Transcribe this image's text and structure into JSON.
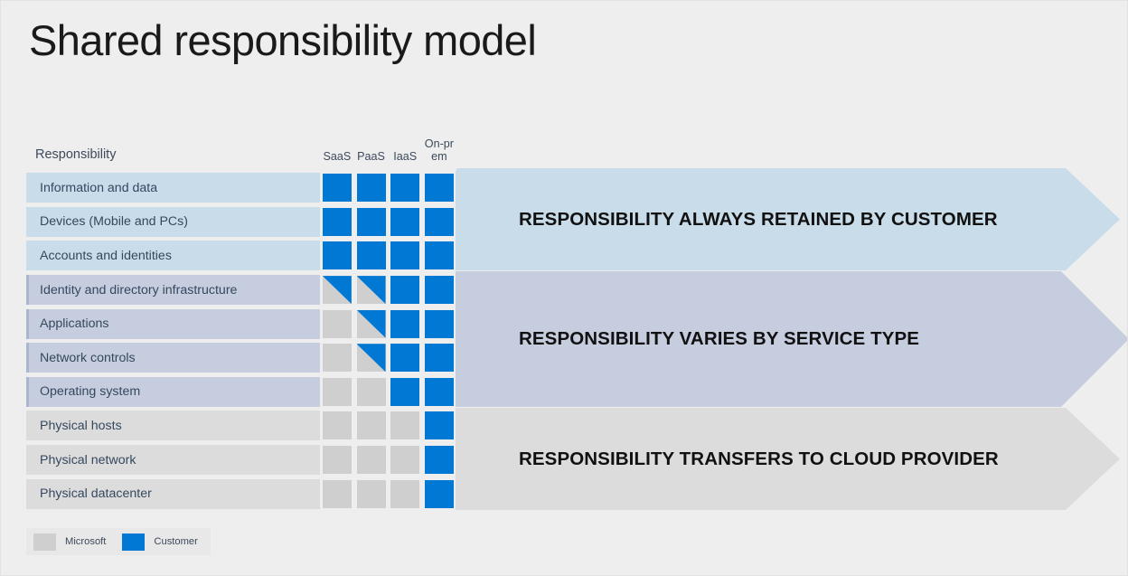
{
  "slide": {
    "title": "Shared responsibility model",
    "background_color": "#eeeeee"
  },
  "colors": {
    "customer_blue": "#0078d4",
    "microsoft_gray": "#cfcfcf",
    "band_customer": "#c9dcea",
    "band_varies": "#c5cddf",
    "band_provider": "#dcdcdc"
  },
  "table": {
    "headers": {
      "responsibility": "Responsibility",
      "columns": [
        "SaaS",
        "PaaS",
        "IaaS",
        "On-prem"
      ]
    },
    "rows": [
      {
        "label": "Information and data",
        "group": 1,
        "cells": [
          "cu",
          "cu",
          "cu",
          "cu"
        ]
      },
      {
        "label": "Devices (Mobile and PCs)",
        "group": 1,
        "cells": [
          "cu",
          "cu",
          "cu",
          "cu"
        ]
      },
      {
        "label": "Accounts and identities",
        "group": 1,
        "cells": [
          "cu",
          "cu",
          "cu",
          "cu"
        ]
      },
      {
        "label": "Identity and directory infrastructure",
        "group": 2,
        "cells": [
          "split",
          "split",
          "cu",
          "cu"
        ]
      },
      {
        "label": "Applications",
        "group": 2,
        "cells": [
          "ms",
          "split",
          "cu",
          "cu"
        ]
      },
      {
        "label": "Network controls",
        "group": 2,
        "cells": [
          "ms",
          "split",
          "cu",
          "cu"
        ]
      },
      {
        "label": "Operating system",
        "group": 2,
        "cells": [
          "ms",
          "ms",
          "cu",
          "cu"
        ]
      },
      {
        "label": "Physical hosts",
        "group": 3,
        "cells": [
          "ms",
          "ms",
          "ms",
          "cu"
        ]
      },
      {
        "label": "Physical network",
        "group": 3,
        "cells": [
          "ms",
          "ms",
          "ms",
          "cu"
        ]
      },
      {
        "label": "Physical datacenter",
        "group": 3,
        "cells": [
          "ms",
          "ms",
          "ms",
          "cu"
        ]
      }
    ]
  },
  "bands": [
    {
      "label": "RESPONSIBILITY ALWAYS RETAINED BY CUSTOMER"
    },
    {
      "label": "RESPONSIBILITY VARIES BY SERVICE TYPE"
    },
    {
      "label": "RESPONSIBILITY TRANSFERS TO CLOUD PROVIDER"
    }
  ],
  "legend": [
    {
      "label": "Microsoft",
      "color": "#cfcfcf"
    },
    {
      "label": "Customer",
      "color": "#0078d4"
    }
  ]
}
